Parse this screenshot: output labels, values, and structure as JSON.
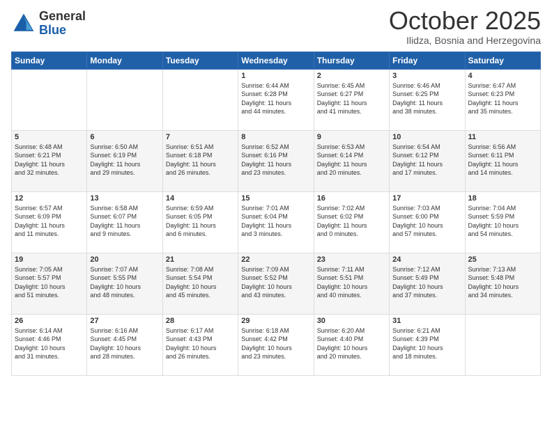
{
  "logo": {
    "general": "General",
    "blue": "Blue"
  },
  "title": "October 2025",
  "subtitle": "Ilidza, Bosnia and Herzegovina",
  "days_of_week": [
    "Sunday",
    "Monday",
    "Tuesday",
    "Wednesday",
    "Thursday",
    "Friday",
    "Saturday"
  ],
  "weeks": [
    [
      {
        "day": "",
        "info": ""
      },
      {
        "day": "",
        "info": ""
      },
      {
        "day": "",
        "info": ""
      },
      {
        "day": "1",
        "info": "Sunrise: 6:44 AM\nSunset: 6:28 PM\nDaylight: 11 hours\nand 44 minutes."
      },
      {
        "day": "2",
        "info": "Sunrise: 6:45 AM\nSunset: 6:27 PM\nDaylight: 11 hours\nand 41 minutes."
      },
      {
        "day": "3",
        "info": "Sunrise: 6:46 AM\nSunset: 6:25 PM\nDaylight: 11 hours\nand 38 minutes."
      },
      {
        "day": "4",
        "info": "Sunrise: 6:47 AM\nSunset: 6:23 PM\nDaylight: 11 hours\nand 35 minutes."
      }
    ],
    [
      {
        "day": "5",
        "info": "Sunrise: 6:48 AM\nSunset: 6:21 PM\nDaylight: 11 hours\nand 32 minutes."
      },
      {
        "day": "6",
        "info": "Sunrise: 6:50 AM\nSunset: 6:19 PM\nDaylight: 11 hours\nand 29 minutes."
      },
      {
        "day": "7",
        "info": "Sunrise: 6:51 AM\nSunset: 6:18 PM\nDaylight: 11 hours\nand 26 minutes."
      },
      {
        "day": "8",
        "info": "Sunrise: 6:52 AM\nSunset: 6:16 PM\nDaylight: 11 hours\nand 23 minutes."
      },
      {
        "day": "9",
        "info": "Sunrise: 6:53 AM\nSunset: 6:14 PM\nDaylight: 11 hours\nand 20 minutes."
      },
      {
        "day": "10",
        "info": "Sunrise: 6:54 AM\nSunset: 6:12 PM\nDaylight: 11 hours\nand 17 minutes."
      },
      {
        "day": "11",
        "info": "Sunrise: 6:56 AM\nSunset: 6:11 PM\nDaylight: 11 hours\nand 14 minutes."
      }
    ],
    [
      {
        "day": "12",
        "info": "Sunrise: 6:57 AM\nSunset: 6:09 PM\nDaylight: 11 hours\nand 11 minutes."
      },
      {
        "day": "13",
        "info": "Sunrise: 6:58 AM\nSunset: 6:07 PM\nDaylight: 11 hours\nand 9 minutes."
      },
      {
        "day": "14",
        "info": "Sunrise: 6:59 AM\nSunset: 6:05 PM\nDaylight: 11 hours\nand 6 minutes."
      },
      {
        "day": "15",
        "info": "Sunrise: 7:01 AM\nSunset: 6:04 PM\nDaylight: 11 hours\nand 3 minutes."
      },
      {
        "day": "16",
        "info": "Sunrise: 7:02 AM\nSunset: 6:02 PM\nDaylight: 11 hours\nand 0 minutes."
      },
      {
        "day": "17",
        "info": "Sunrise: 7:03 AM\nSunset: 6:00 PM\nDaylight: 10 hours\nand 57 minutes."
      },
      {
        "day": "18",
        "info": "Sunrise: 7:04 AM\nSunset: 5:59 PM\nDaylight: 10 hours\nand 54 minutes."
      }
    ],
    [
      {
        "day": "19",
        "info": "Sunrise: 7:05 AM\nSunset: 5:57 PM\nDaylight: 10 hours\nand 51 minutes."
      },
      {
        "day": "20",
        "info": "Sunrise: 7:07 AM\nSunset: 5:55 PM\nDaylight: 10 hours\nand 48 minutes."
      },
      {
        "day": "21",
        "info": "Sunrise: 7:08 AM\nSunset: 5:54 PM\nDaylight: 10 hours\nand 45 minutes."
      },
      {
        "day": "22",
        "info": "Sunrise: 7:09 AM\nSunset: 5:52 PM\nDaylight: 10 hours\nand 43 minutes."
      },
      {
        "day": "23",
        "info": "Sunrise: 7:11 AM\nSunset: 5:51 PM\nDaylight: 10 hours\nand 40 minutes."
      },
      {
        "day": "24",
        "info": "Sunrise: 7:12 AM\nSunset: 5:49 PM\nDaylight: 10 hours\nand 37 minutes."
      },
      {
        "day": "25",
        "info": "Sunrise: 7:13 AM\nSunset: 5:48 PM\nDaylight: 10 hours\nand 34 minutes."
      }
    ],
    [
      {
        "day": "26",
        "info": "Sunrise: 6:14 AM\nSunset: 4:46 PM\nDaylight: 10 hours\nand 31 minutes."
      },
      {
        "day": "27",
        "info": "Sunrise: 6:16 AM\nSunset: 4:45 PM\nDaylight: 10 hours\nand 28 minutes."
      },
      {
        "day": "28",
        "info": "Sunrise: 6:17 AM\nSunset: 4:43 PM\nDaylight: 10 hours\nand 26 minutes."
      },
      {
        "day": "29",
        "info": "Sunrise: 6:18 AM\nSunset: 4:42 PM\nDaylight: 10 hours\nand 23 minutes."
      },
      {
        "day": "30",
        "info": "Sunrise: 6:20 AM\nSunset: 4:40 PM\nDaylight: 10 hours\nand 20 minutes."
      },
      {
        "day": "31",
        "info": "Sunrise: 6:21 AM\nSunset: 4:39 PM\nDaylight: 10 hours\nand 18 minutes."
      },
      {
        "day": "",
        "info": ""
      }
    ]
  ]
}
